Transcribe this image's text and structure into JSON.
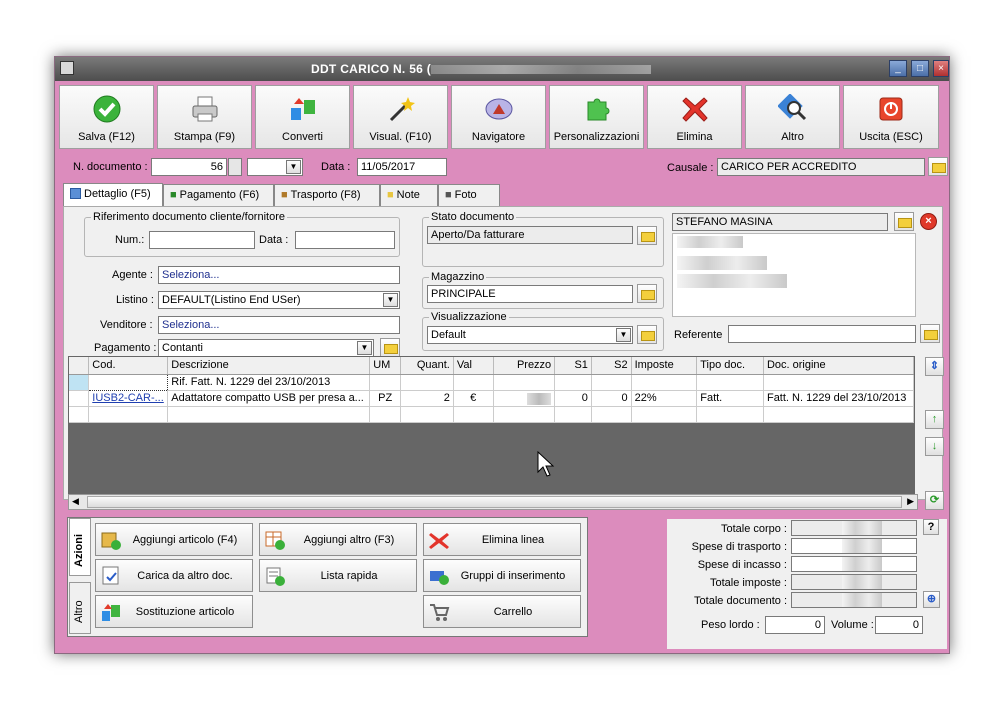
{
  "window": {
    "title": "DDT CARICO N. 56 ("
  },
  "toolbar": [
    {
      "label": "Salva (F12)",
      "icon": "check-icon"
    },
    {
      "label": "Stampa (F9)",
      "icon": "printer-icon"
    },
    {
      "label": "Converti",
      "icon": "convert-icon"
    },
    {
      "label": "Visual. (F10)",
      "icon": "magic-wand-icon"
    },
    {
      "label": "Navigatore",
      "icon": "compass-icon"
    },
    {
      "label": "Personalizzazioni",
      "icon": "puzzle-icon"
    },
    {
      "label": "Elimina",
      "icon": "delete-x-icon"
    },
    {
      "label": "Altro",
      "icon": "magnifier-icon"
    },
    {
      "label": "Uscita (ESC)",
      "icon": "power-icon"
    }
  ],
  "header": {
    "num_label": "N. documento :",
    "num_value": "56",
    "date_label": "Data :",
    "date_value": "11/05/2017",
    "causale_label": "Causale :",
    "causale_value": "CARICO PER ACCREDITO"
  },
  "tabs": [
    "Dettaglio (F5)",
    "Pagamento (F6)",
    "Trasporto (F8)",
    "Note",
    "Foto"
  ],
  "riferimento": {
    "title": "Riferimento documento cliente/fornitore",
    "num_label": "Num.:",
    "data_label": "Data :"
  },
  "form": {
    "agente_label": "Agente :",
    "agente_value": "Seleziona...",
    "listino_label": "Listino :",
    "listino_value": "DEFAULT(Listino End USer)",
    "venditore_label": "Venditore :",
    "venditore_value": "Seleziona...",
    "pagamento_label": "Pagamento :",
    "pagamento_value": "Contanti"
  },
  "stato": {
    "title": "Stato documento",
    "value": "Aperto/Da fatturare"
  },
  "magazzino": {
    "title": "Magazzino",
    "value": "PRINCIPALE"
  },
  "visualizzazione": {
    "title": "Visualizzazione",
    "value": "Default"
  },
  "cliente": {
    "name": "STEFANO MASINA",
    "referente_label": "Referente"
  },
  "grid": {
    "columns": [
      "Cod.",
      "Descrizione",
      "UM",
      "Quant.",
      "Val",
      "Prezzo",
      "S1",
      "S2",
      "Imposte",
      "Tipo doc.",
      "Doc. origine"
    ],
    "rows": [
      [
        "",
        "Rif. Fatt. N. 1229 del 23/10/2013",
        "",
        "",
        "",
        "",
        "",
        "",
        "",
        "",
        ""
      ],
      [
        "IUSB2-CAR-...",
        "Adattatore compatto USB per presa a...",
        "PZ",
        "2",
        "€",
        "",
        "0",
        "0",
        "22%",
        "Fatt.",
        "Fatt. N. 1229 del 23/10/2013"
      ]
    ]
  },
  "actions": {
    "tab_azioni": "Azioni",
    "tab_altro": "Altro",
    "buttons": [
      {
        "label": "Aggiungi articolo (F4)",
        "icon": "box-add-icon"
      },
      {
        "label": "Aggiungi altro (F3)",
        "icon": "grid-add-icon"
      },
      {
        "label": "Elimina linea",
        "icon": "delete-x-icon"
      },
      {
        "label": "Carica da altro doc.",
        "icon": "document-check-icon"
      },
      {
        "label": "Lista rapida",
        "icon": "list-add-icon"
      },
      {
        "label": "Gruppi di inserimento",
        "icon": "group-add-icon"
      },
      {
        "label": "Sostituzione articolo",
        "icon": "replace-icon"
      },
      {
        "label": "Carrello",
        "icon": "cart-icon"
      }
    ]
  },
  "totals": {
    "totale_corpo": "Totale corpo :",
    "spese_trasporto": "Spese di trasporto :",
    "spese_incasso": "Spese di incasso :",
    "totale_imposte": "Totale imposte :",
    "totale_documento": "Totale documento :",
    "peso_label": "Peso lordo :",
    "peso_value": "0",
    "volume_label": "Volume :",
    "volume_value": "0"
  }
}
